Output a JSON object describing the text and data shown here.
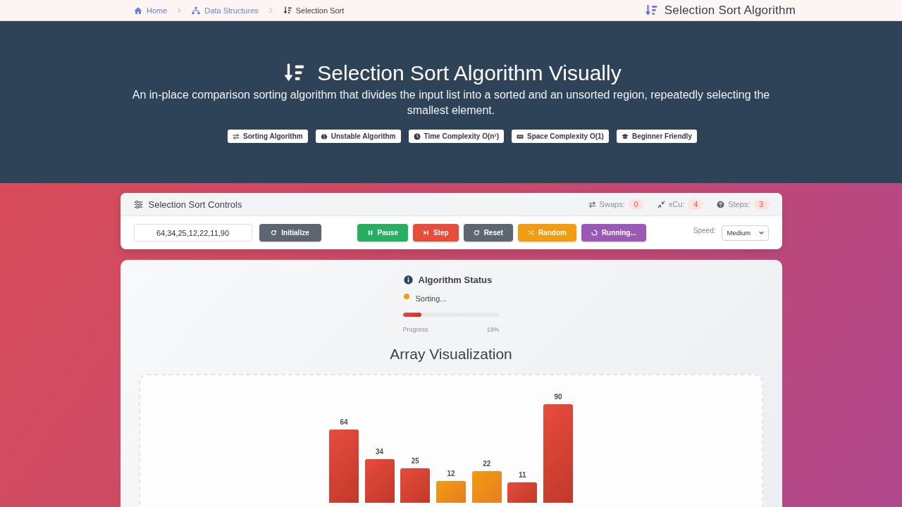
{
  "breadcrumb": [
    {
      "label": "Home",
      "current": false
    },
    {
      "label": "Data Structures",
      "current": false
    },
    {
      "label": "Selection Sort",
      "current": true
    }
  ],
  "page_title": "Selection Sort Algorithm",
  "hero": {
    "title": "Selection Sort Algorithm Visually",
    "description": "An in-place comparison sorting algorithm that divides the input list into a sorted and an unsorted region, repeatedly selecting the smallest element.",
    "badges": [
      "Sorting Algorithm",
      "Unstable Algorithm",
      "Time Complexity O(n²)",
      "Space Complexity O(1)",
      "Beginner Friendly"
    ]
  },
  "controls": {
    "title": "Selection Sort Controls",
    "stats": [
      {
        "label": "Swaps:",
        "value": "0"
      },
      {
        "label": "xCu:",
        "value": "4"
      },
      {
        "label": "Steps:",
        "value": "3"
      }
    ],
    "array_input": {
      "value": "64,34,25,12,22,11,90"
    },
    "initialize_button": {
      "label": "Initialize"
    },
    "buttons": [
      {
        "label": "Pause",
        "color": "#27ae60"
      },
      {
        "label": "Step",
        "color": "#e74c3c"
      },
      {
        "label": "Reset",
        "color": "#5d6770"
      },
      {
        "label": "Random",
        "color": "#f39c12"
      },
      {
        "label": "Running...",
        "color": "#9b59b6"
      }
    ],
    "speed": {
      "label": "Speed:",
      "value": "Medium"
    }
  },
  "status": {
    "title": "Algorithm Status",
    "state": "Sorting...",
    "color": "#f39c12",
    "progress": {
      "label": "Progress",
      "level": 0.19,
      "reading": "19%"
    }
  },
  "visualization": {
    "title": "Array Visualization",
    "elements": [
      {
        "value": "64",
        "highlighted": false
      },
      {
        "value": "34",
        "highlighted": false
      },
      {
        "value": "25",
        "highlighted": false
      },
      {
        "value": "12",
        "highlighted": true
      },
      {
        "value": "22",
        "highlighted": true
      },
      {
        "value": "11",
        "highlighted": false
      },
      {
        "value": "90",
        "highlighted": false
      }
    ]
  }
}
